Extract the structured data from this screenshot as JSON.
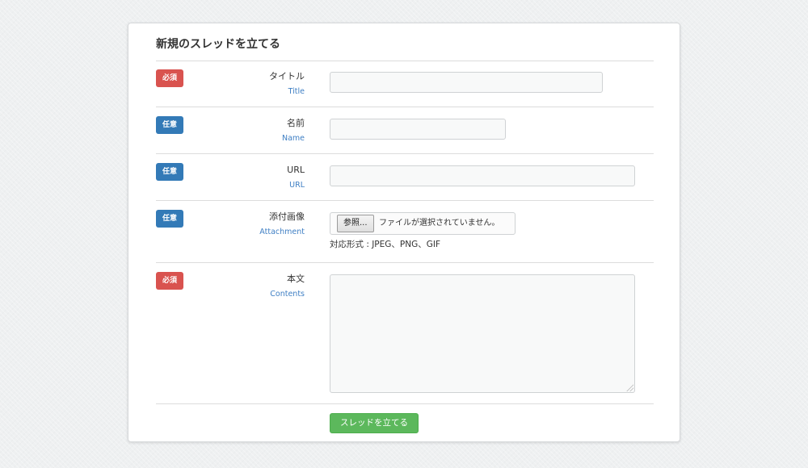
{
  "form": {
    "title": "新規のスレッドを立てる",
    "fields": {
      "title": {
        "badge": "必須",
        "label": "タイトル",
        "label_en": "Title",
        "value": "",
        "placeholder": ""
      },
      "name": {
        "badge": "任意",
        "label": "名前",
        "label_en": "Name",
        "value": "",
        "placeholder": ""
      },
      "url": {
        "badge": "任意",
        "label": "URL",
        "label_en": "URL",
        "value": "",
        "placeholder": ""
      },
      "attachment": {
        "badge": "任意",
        "label": "添付画像",
        "label_en": "Attachment",
        "browse_label": "参照...",
        "status": "ファイルが選択されていません。",
        "formats_note": "対応形式 : JPEG、PNG、GIF"
      },
      "contents": {
        "badge": "必須",
        "label": "本文",
        "label_en": "Contents",
        "value": "",
        "placeholder": ""
      }
    },
    "submit_label": "スレッドを立てる"
  },
  "colors": {
    "required_badge": "#d9534f",
    "optional_badge": "#337ab7",
    "english_label": "#3f7fc4",
    "submit_button": "#5cb85c",
    "background": "#eef0f1"
  }
}
